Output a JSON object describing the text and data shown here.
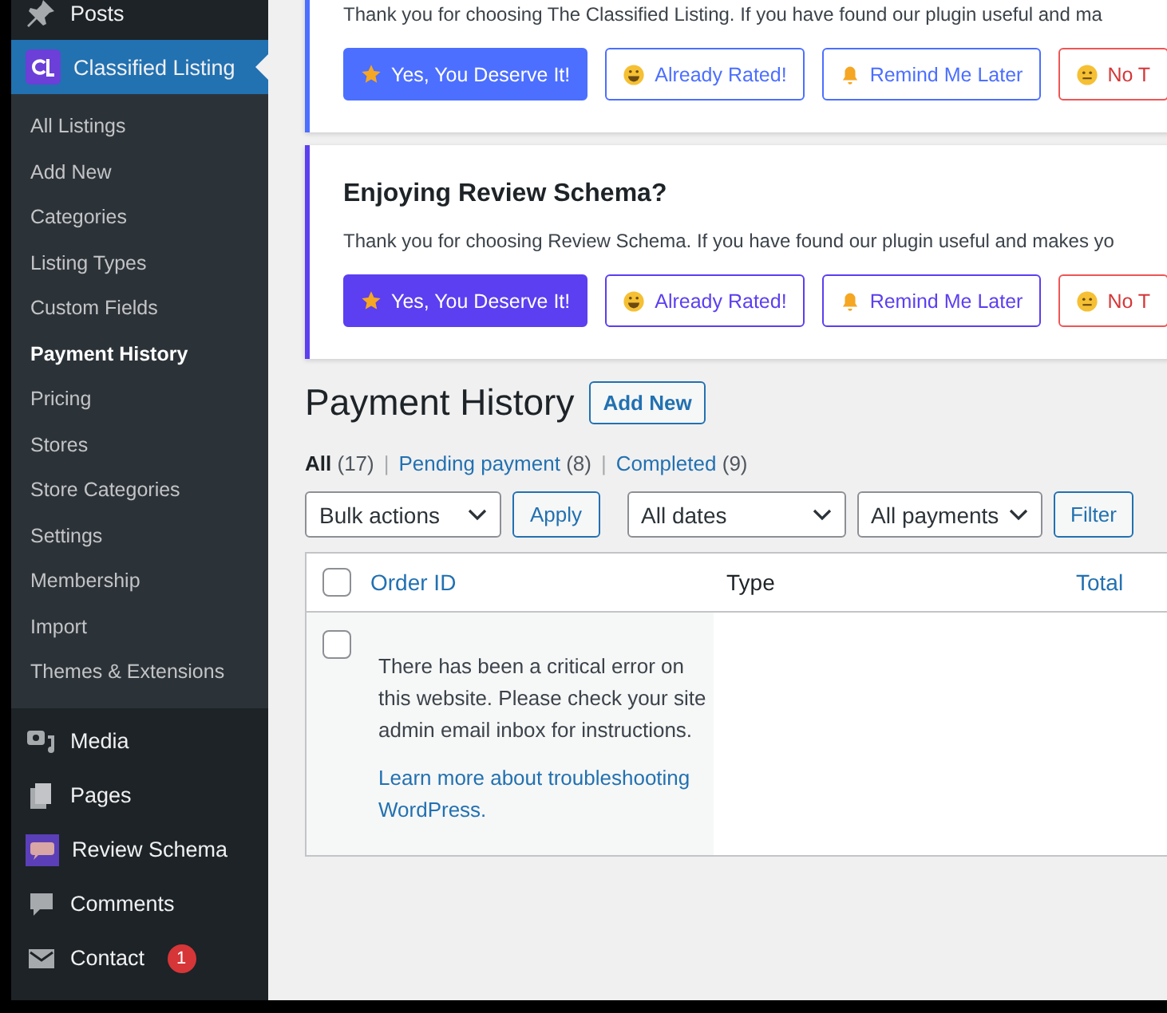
{
  "sidebar": {
    "items": [
      {
        "label": "Posts",
        "selected": false
      },
      {
        "label": "Classified Listing",
        "selected": true,
        "children": [
          {
            "label": "All Listings",
            "selected": false
          },
          {
            "label": "Add New",
            "selected": false
          },
          {
            "label": "Categories",
            "selected": false
          },
          {
            "label": "Listing Types",
            "selected": false
          },
          {
            "label": "Custom Fields",
            "selected": false
          },
          {
            "label": "Payment History",
            "selected": true
          },
          {
            "label": "Pricing",
            "selected": false
          },
          {
            "label": "Stores",
            "selected": false
          },
          {
            "label": "Store Categories",
            "selected": false
          },
          {
            "label": "Settings",
            "selected": false
          },
          {
            "label": "Membership",
            "selected": false
          },
          {
            "label": "Import",
            "selected": false
          },
          {
            "label": "Themes & Extensions",
            "selected": false
          }
        ]
      },
      {
        "label": "Media",
        "selected": false
      },
      {
        "label": "Pages",
        "selected": false
      },
      {
        "label": "Review Schema",
        "selected": false
      },
      {
        "label": "Comments",
        "selected": false
      },
      {
        "label": "Contact",
        "selected": false,
        "badge": "1"
      }
    ]
  },
  "notices": [
    {
      "text": "Thank you for choosing The Classified Listing. If you have found our plugin useful and ma",
      "color": "#4c6fff",
      "buttons": [
        {
          "label": "Yes, You Deserve It!",
          "kind": "primary"
        },
        {
          "label": "Already Rated!",
          "kind": "outline"
        },
        {
          "label": "Remind Me Later",
          "kind": "outline"
        },
        {
          "label": "No T",
          "kind": "danger"
        }
      ]
    },
    {
      "title": "Enjoying Review Schema?",
      "text": "Thank you for choosing Review Schema. If you have found our plugin useful and makes yo",
      "color": "#5b3ff0",
      "buttons": [
        {
          "label": "Yes, You Deserve It!",
          "kind": "primary"
        },
        {
          "label": "Already Rated!",
          "kind": "outline"
        },
        {
          "label": "Remind Me Later",
          "kind": "outline"
        },
        {
          "label": "No T",
          "kind": "danger"
        }
      ]
    }
  ],
  "page": {
    "title": "Payment History",
    "add_button": "Add New"
  },
  "views": [
    {
      "label": "All",
      "count": "(17)",
      "selected": true
    },
    {
      "label": "Pending payment",
      "count": "(8)",
      "selected": false
    },
    {
      "label": "Completed",
      "count": "(9)",
      "selected": false
    }
  ],
  "separator": "|",
  "filters": {
    "bulk": "Bulk actions",
    "apply": "Apply",
    "dates": "All dates",
    "payments": "All payments",
    "filter": "Filter"
  },
  "table": {
    "header_checked": false,
    "columns": [
      {
        "label": "Order ID",
        "sortable": true
      },
      {
        "label": "Type",
        "sortable": false
      },
      {
        "label": "Total",
        "sortable": true
      }
    ],
    "rows": [
      {
        "checked": false,
        "message": "There has been a critical error on this website. Please check your site admin email inbox for instructions.",
        "link": "Learn more about troubleshooting WordPress."
      }
    ]
  }
}
